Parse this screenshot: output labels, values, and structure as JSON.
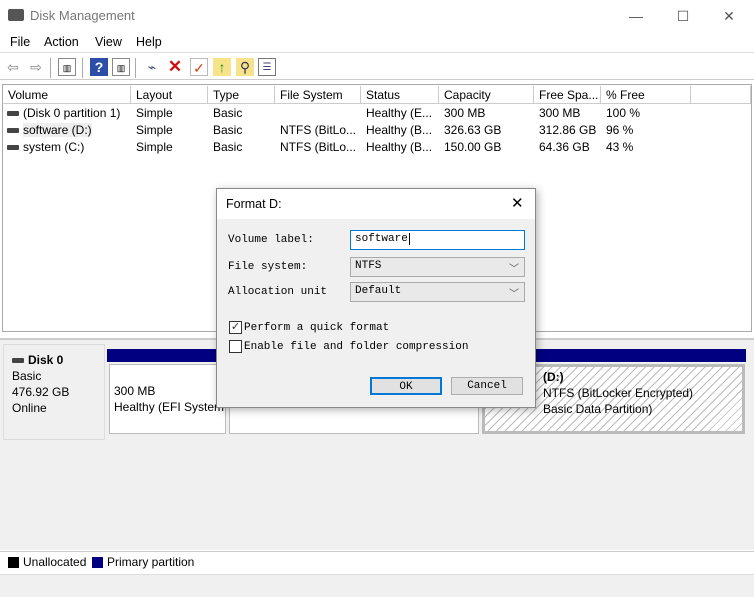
{
  "window": {
    "title": "Disk Management",
    "min": "—",
    "max": "☐",
    "close": "✕"
  },
  "menu": [
    "File",
    "Action",
    "View",
    "Help"
  ],
  "toolbar": {
    "icons": [
      "back-icon",
      "forward-icon",
      "console-tree-icon",
      "help-icon",
      "action-pane-icon",
      "connect-icon",
      "delete-icon",
      "properties-icon",
      "folder-up-icon",
      "search-folder-icon",
      "list-icon"
    ]
  },
  "table": {
    "columns": [
      "Volume",
      "Layout",
      "Type",
      "File System",
      "Status",
      "Capacity",
      "Free Spa...",
      "% Free"
    ],
    "rows": [
      [
        "(Disk 0 partition 1)",
        "Simple",
        "Basic",
        "",
        "Healthy (E...",
        "300 MB",
        "300 MB",
        "100 %"
      ],
      [
        "software (D:)",
        "Simple",
        "Basic",
        "NTFS (BitLo...",
        "Healthy (B...",
        "326.63 GB",
        "312.86 GB",
        "96 %"
      ],
      [
        "system (C:)",
        "Simple",
        "Basic",
        "NTFS (BitLo...",
        "Healthy (B...",
        "150.00 GB",
        "64.36 GB",
        "43 %"
      ]
    ]
  },
  "disk": {
    "name": "Disk 0",
    "type": "Basic",
    "size": "476.92 GB",
    "state": "Online",
    "partitions": [
      {
        "line1": "300 MB",
        "line2": "Healthy (EFI System"
      },
      {
        "line1": "",
        "line2": ""
      },
      {
        "title": "(D:)",
        "line1": "NTFS (BitLocker Encrypted)",
        "line2": "Basic Data Partition)"
      }
    ]
  },
  "legend": {
    "unallocated": "Unallocated",
    "primary": "Primary partition",
    "colors": {
      "unallocated": "#000000",
      "primary": "#000080"
    }
  },
  "dialog": {
    "title": "Format D:",
    "volume_label_caption": "Volume label:",
    "volume_label": "software",
    "fs_caption": "File system:",
    "fs": "NTFS",
    "alloc_caption": "Allocation unit",
    "alloc": "Default",
    "quick_format": "Perform a quick format",
    "quick_checked": true,
    "compression": "Enable file and folder compression",
    "ok": "OK",
    "cancel": "Cancel",
    "close": "✕"
  }
}
